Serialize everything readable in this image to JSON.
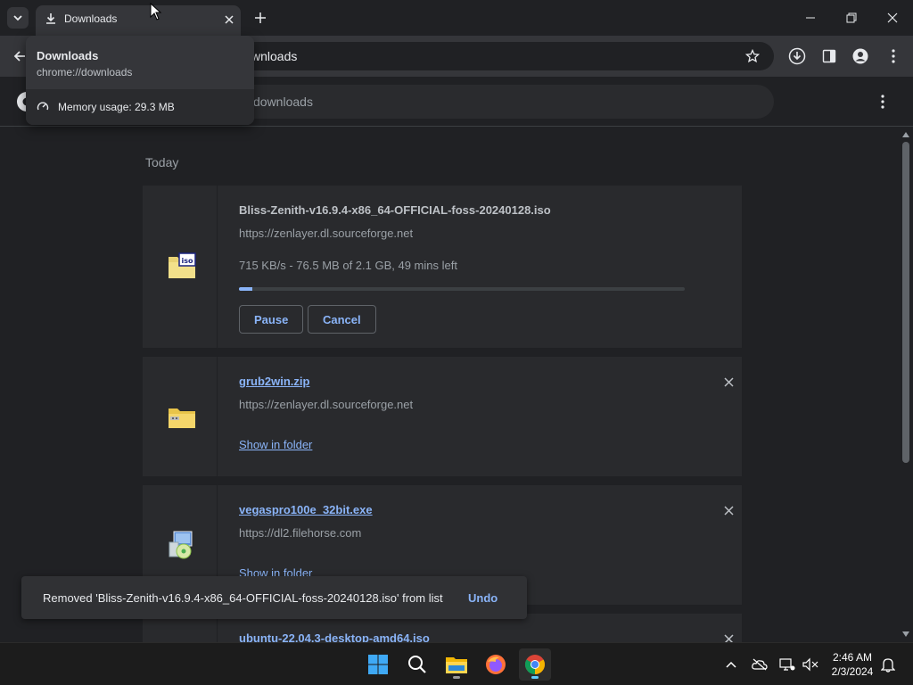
{
  "window": {
    "tab_title": "Downloads"
  },
  "toolbar": {
    "address_text": "wnloads"
  },
  "downloads_page": {
    "search_placeholder": "downloads",
    "date_group": "Today",
    "items": [
      {
        "filename": "Bliss-Zenith-v16.9.4-x86_64-OFFICIAL-foss-20240128.iso",
        "source": "https://zenlayer.dl.sourceforge.net",
        "status": "715 KB/s - 76.5 MB of 2.1 GB, 49 mins left",
        "progress": 0.03,
        "pause_label": "Pause",
        "cancel_label": "Cancel",
        "icon": "iso-file-icon"
      },
      {
        "filename": "grub2win.zip",
        "source": "https://zenlayer.dl.sourceforge.net",
        "action_label": "Show in folder",
        "icon": "zip-folder-icon"
      },
      {
        "filename": "vegaspro100e_32bit.exe",
        "source": "https://dl2.filehorse.com",
        "action_label": "Show in folder",
        "icon": "installer-icon"
      },
      {
        "filename": "ubuntu-22.04.3-desktop-amd64.iso"
      }
    ]
  },
  "hovercard": {
    "title": "Downloads",
    "url": "chrome://downloads",
    "memory": "Memory usage: 29.3 MB"
  },
  "toast": {
    "message": "Removed 'Bliss-Zenith-v16.9.4-x86_64-OFFICIAL-foss-20240128.iso' from list",
    "undo_label": "Undo"
  },
  "taskbar": {
    "time": "2:46 AM",
    "date": "2/3/2024"
  },
  "colors": {
    "accent": "#8ab4f8",
    "background": "#202124",
    "card": "#292a2d"
  }
}
